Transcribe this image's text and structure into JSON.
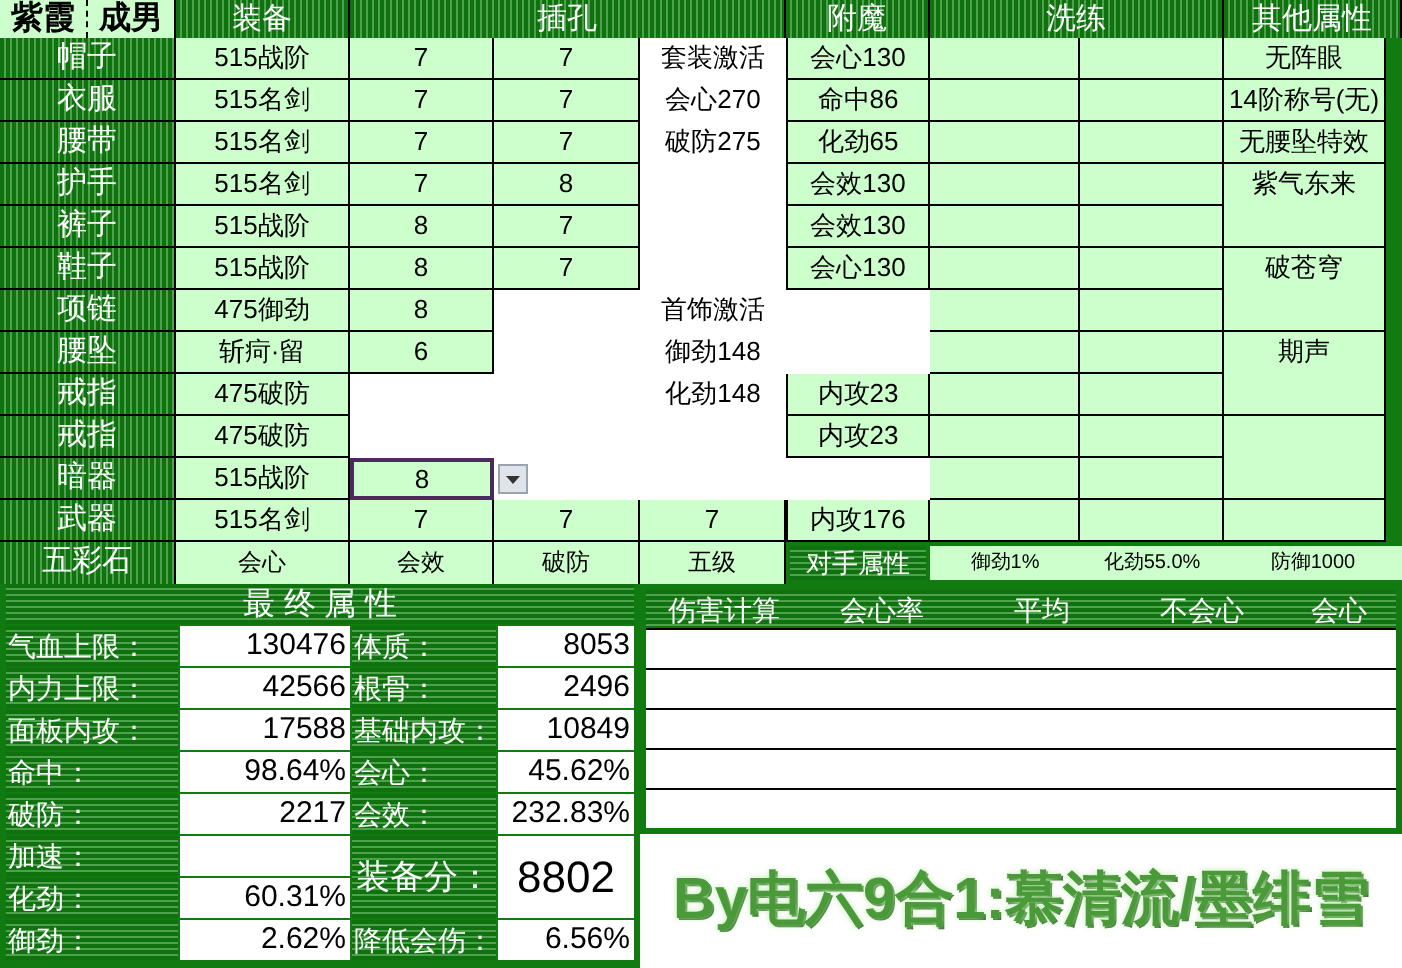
{
  "header": {
    "tag": "紫霞",
    "gender": "成男",
    "columns": [
      "装备",
      "插孔",
      "附魔",
      "洗练",
      "其他属性"
    ]
  },
  "equipment": [
    {
      "slot": "帽子",
      "item": "515战阶",
      "sockets": [
        "7",
        "7"
      ],
      "enchant": "会心130",
      "active": false
    },
    {
      "slot": "衣服",
      "item": "515名剑",
      "sockets": [
        "7",
        "7"
      ],
      "enchant": "命中86",
      "active": false
    },
    {
      "slot": "腰带",
      "item": "515名剑",
      "sockets": [
        "7",
        "7"
      ],
      "enchant": "化劲65",
      "active": false
    },
    {
      "slot": "护手",
      "item": "515名剑",
      "sockets": [
        "7",
        "8"
      ],
      "enchant": "会效130",
      "active": false
    },
    {
      "slot": "裤子",
      "item": "515战阶",
      "sockets": [
        "8",
        "7"
      ],
      "enchant": "会效130",
      "active": false
    },
    {
      "slot": "鞋子",
      "item": "515战阶",
      "sockets": [
        "8",
        "7"
      ],
      "enchant": "会心130",
      "active": false
    },
    {
      "slot": "项链",
      "item": "475御劲",
      "sockets": [
        "8"
      ],
      "active": false
    },
    {
      "slot": "腰坠",
      "item": "斩疴·留",
      "sockets": [
        "6"
      ],
      "active": false
    },
    {
      "slot": "戒指",
      "item": "475破防",
      "enchant": "内攻23",
      "active": false
    },
    {
      "slot": "戒指",
      "item": "475破防",
      "enchant": "内攻23",
      "active": false
    },
    {
      "slot": "暗器",
      "item": "515战阶",
      "sockets": [
        "8"
      ],
      "active": true
    },
    {
      "slot": "武器",
      "item": "515名剑",
      "sockets": [
        "7",
        "7",
        "7"
      ],
      "enchant": "内攻176",
      "active": false
    }
  ],
  "set_bonus": {
    "title": "套装激活",
    "lines": [
      "会心270",
      "破防275"
    ]
  },
  "accessory_bonus": {
    "title": "首饰激活",
    "lines": [
      "御劲148",
      "化劲148"
    ]
  },
  "other_attributes": [
    "无阵眼",
    "14阶称号(无)",
    "无腰坠特效",
    "紫气东来",
    "破苍穹",
    "期声"
  ],
  "gem_row": {
    "label": "五彩石",
    "values": [
      "会心",
      "会效",
      "破防",
      "五级"
    ]
  },
  "opponent": {
    "label": "对手属性",
    "values": [
      "御劲1%",
      "化劲55.0%",
      "防御1000"
    ]
  },
  "final_stats": {
    "title": "最 终 属 性",
    "left": [
      {
        "label": "气血上限：",
        "value": "130476"
      },
      {
        "label": "内力上限：",
        "value": "42566"
      },
      {
        "label": "面板内攻：",
        "value": "17588"
      },
      {
        "label": "命中：",
        "value": "98.64%"
      },
      {
        "label": "破防：",
        "value": "2217"
      },
      {
        "label": "加速："
      },
      {
        "label": "化劲：",
        "value": "60.31%"
      },
      {
        "label": "御劲：",
        "value": "2.62%"
      }
    ],
    "right": [
      {
        "label": "体质：",
        "value": "8053"
      },
      {
        "label": "根骨：",
        "value": "2496"
      },
      {
        "label": "基础内攻：",
        "value": "10849"
      },
      {
        "label": "会心：",
        "value": "45.62%"
      },
      {
        "label": "会效：",
        "value": "232.83%"
      }
    ],
    "score": {
      "label": "装备分：",
      "value": "8802"
    },
    "damage_reduction": {
      "label": "降低会伤：",
      "value": "6.56%"
    }
  },
  "damage": {
    "columns": [
      "伤害计算",
      "会心率",
      "平均",
      "不会心",
      "会心"
    ]
  },
  "credit": "By电六9合1:慕清流/墨绯雪"
}
